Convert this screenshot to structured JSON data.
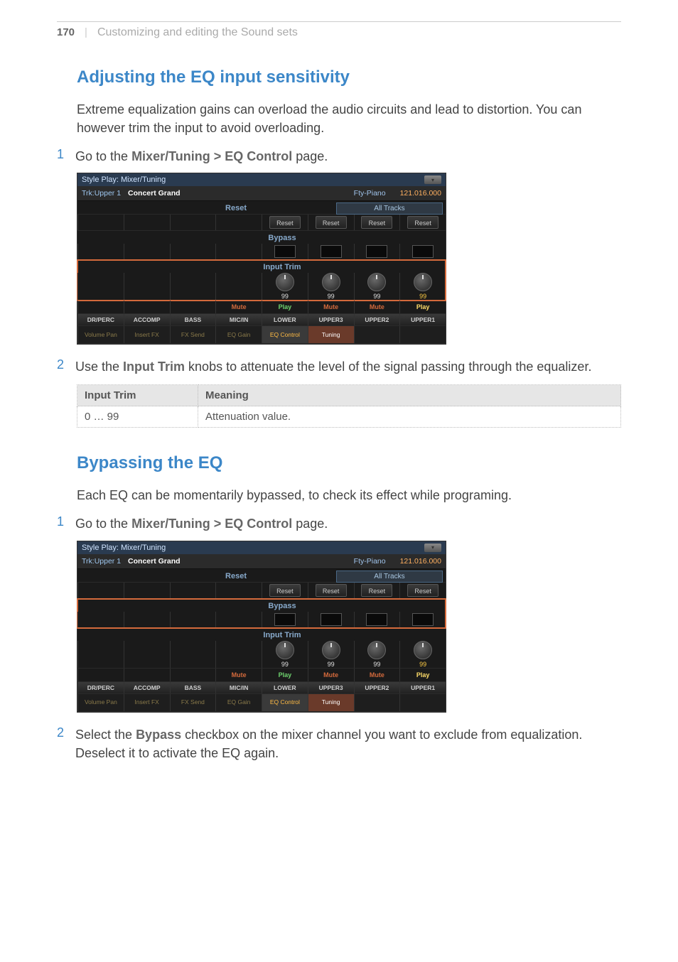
{
  "page": {
    "number": "170",
    "sep": "|",
    "chapter": "Customizing and editing the Sound sets"
  },
  "s1": {
    "title": "Adjusting the EQ input sensitivity",
    "intro": "Extreme equalization gains can overload the audio circuits and lead to distortion. You can however trim the input to avoid overloading.",
    "step1_pre": "Go to the ",
    "step1_ui": "Mixer/Tuning > EQ Control",
    "step1_post": " page.",
    "step2_pre": "Use the ",
    "step2_ui": "Input Trim",
    "step2_post": " knobs to attenuate the level of the signal passing through the equalizer."
  },
  "param_table": {
    "h1": "Input Trim",
    "h2": "Meaning",
    "r1c1": "0 … 99",
    "r1c2": "Attenuation value."
  },
  "s2": {
    "title": "Bypassing the EQ",
    "intro": "Each EQ can be momentarily bypassed, to check its effect while programing.",
    "step1_pre": "Go to the ",
    "step1_ui": "Mixer/Tuning > EQ Control",
    "step1_post": " page.",
    "step2_pre": "Select the ",
    "step2_ui": "Bypass",
    "step2_post": " checkbox on the mixer channel you want to exclude from equalization. Deselect it to activate the EQ again."
  },
  "mixer": {
    "windowTitle": "Style Play: Mixer/Tuning",
    "trk": "Trk:Upper 1",
    "sound": "Concert Grand",
    "category": "Fty-Piano",
    "bankprg": "121.016.000",
    "labels": {
      "reset": "Reset",
      "bypass": "Bypass",
      "inputTrim": "Input Trim",
      "allTracks": "All Tracks"
    },
    "resetBtn": "Reset",
    "inputTrimVals": [
      "",
      "",
      "",
      "",
      "99",
      "99",
      "99",
      "99"
    ],
    "mp": [
      "",
      "",
      "",
      "Mute",
      "Play",
      "Mute",
      "Mute",
      "Play"
    ],
    "cols": [
      "DR/PERC",
      "ACCOMP",
      "BASS",
      "MIC/IN",
      "LOWER",
      "UPPER3",
      "UPPER2",
      "UPPER1"
    ],
    "tabs": [
      "Volume Pan",
      "Insert FX",
      "FX Send",
      "EQ Gain",
      "EQ Control",
      "Tuning",
      "",
      ""
    ]
  }
}
